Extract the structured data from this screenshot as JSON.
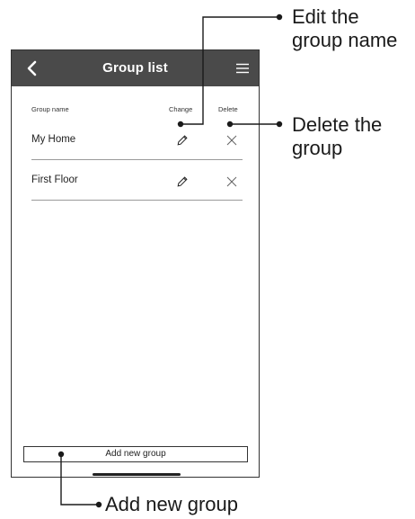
{
  "appbar": {
    "title": "Group list"
  },
  "table": {
    "headers": {
      "name": "Group name",
      "change": "Change",
      "delete": "Delete"
    },
    "rows": [
      {
        "name": "My Home"
      },
      {
        "name": "First Floor"
      }
    ]
  },
  "add_button": {
    "label": "Add new group"
  },
  "callouts": {
    "edit_line1": "Edit the",
    "edit_line2": "group name",
    "delete_line1": "Delete the",
    "delete_line2": "group",
    "add": "Add new group"
  },
  "colors": {
    "appbar": "#4a4a4a",
    "text": "#1a1a1a",
    "divider": "#9a9a9a"
  },
  "icons": [
    "chevron-left-icon",
    "hamburger-menu-icon",
    "pencil-icon",
    "close-icon"
  ]
}
